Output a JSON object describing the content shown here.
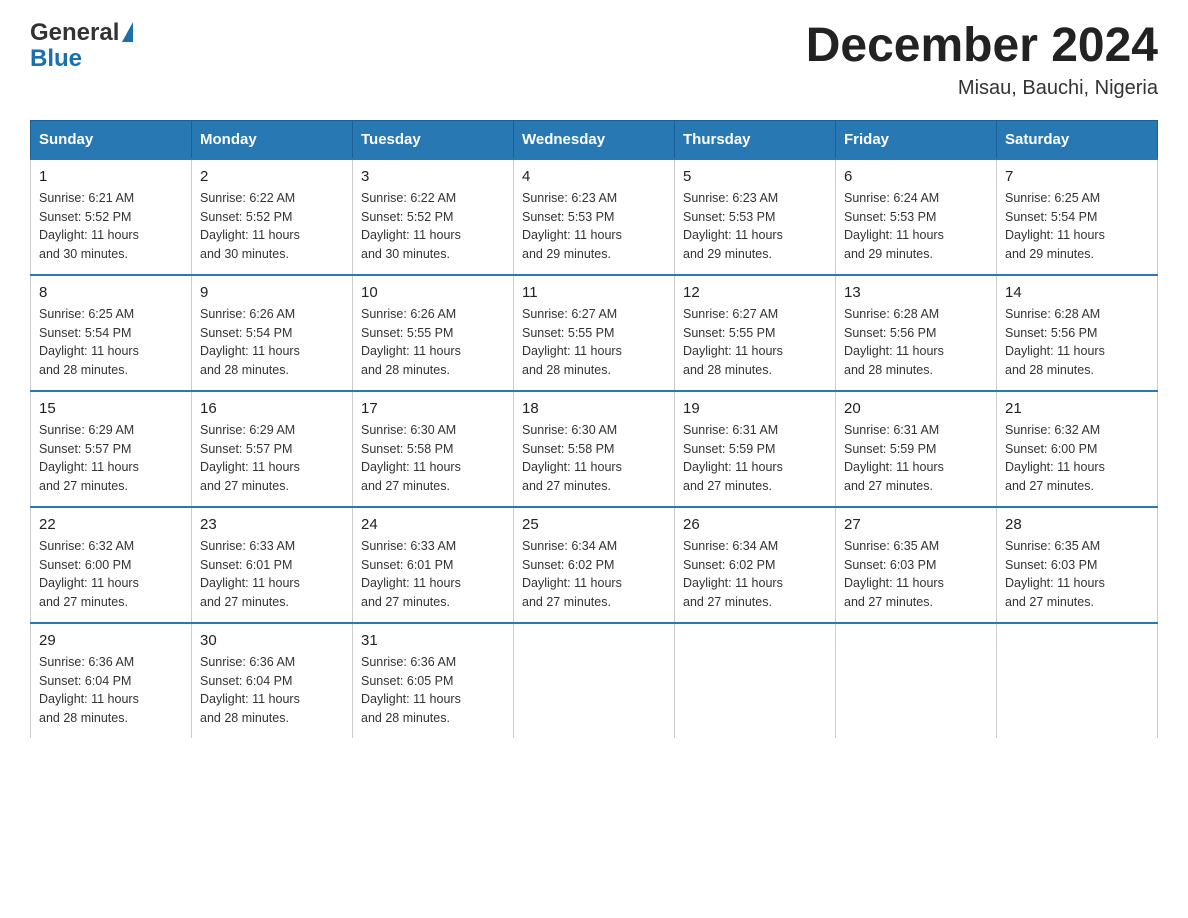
{
  "header": {
    "logo_general": "General",
    "logo_blue": "Blue",
    "month_title": "December 2024",
    "location": "Misau, Bauchi, Nigeria"
  },
  "days_of_week": [
    "Sunday",
    "Monday",
    "Tuesday",
    "Wednesday",
    "Thursday",
    "Friday",
    "Saturday"
  ],
  "weeks": [
    [
      {
        "day": "1",
        "sunrise": "6:21 AM",
        "sunset": "5:52 PM",
        "daylight": "11 hours and 30 minutes."
      },
      {
        "day": "2",
        "sunrise": "6:22 AM",
        "sunset": "5:52 PM",
        "daylight": "11 hours and 30 minutes."
      },
      {
        "day": "3",
        "sunrise": "6:22 AM",
        "sunset": "5:52 PM",
        "daylight": "11 hours and 30 minutes."
      },
      {
        "day": "4",
        "sunrise": "6:23 AM",
        "sunset": "5:53 PM",
        "daylight": "11 hours and 29 minutes."
      },
      {
        "day": "5",
        "sunrise": "6:23 AM",
        "sunset": "5:53 PM",
        "daylight": "11 hours and 29 minutes."
      },
      {
        "day": "6",
        "sunrise": "6:24 AM",
        "sunset": "5:53 PM",
        "daylight": "11 hours and 29 minutes."
      },
      {
        "day": "7",
        "sunrise": "6:25 AM",
        "sunset": "5:54 PM",
        "daylight": "11 hours and 29 minutes."
      }
    ],
    [
      {
        "day": "8",
        "sunrise": "6:25 AM",
        "sunset": "5:54 PM",
        "daylight": "11 hours and 28 minutes."
      },
      {
        "day": "9",
        "sunrise": "6:26 AM",
        "sunset": "5:54 PM",
        "daylight": "11 hours and 28 minutes."
      },
      {
        "day": "10",
        "sunrise": "6:26 AM",
        "sunset": "5:55 PM",
        "daylight": "11 hours and 28 minutes."
      },
      {
        "day": "11",
        "sunrise": "6:27 AM",
        "sunset": "5:55 PM",
        "daylight": "11 hours and 28 minutes."
      },
      {
        "day": "12",
        "sunrise": "6:27 AM",
        "sunset": "5:55 PM",
        "daylight": "11 hours and 28 minutes."
      },
      {
        "day": "13",
        "sunrise": "6:28 AM",
        "sunset": "5:56 PM",
        "daylight": "11 hours and 28 minutes."
      },
      {
        "day": "14",
        "sunrise": "6:28 AM",
        "sunset": "5:56 PM",
        "daylight": "11 hours and 28 minutes."
      }
    ],
    [
      {
        "day": "15",
        "sunrise": "6:29 AM",
        "sunset": "5:57 PM",
        "daylight": "11 hours and 27 minutes."
      },
      {
        "day": "16",
        "sunrise": "6:29 AM",
        "sunset": "5:57 PM",
        "daylight": "11 hours and 27 minutes."
      },
      {
        "day": "17",
        "sunrise": "6:30 AM",
        "sunset": "5:58 PM",
        "daylight": "11 hours and 27 minutes."
      },
      {
        "day": "18",
        "sunrise": "6:30 AM",
        "sunset": "5:58 PM",
        "daylight": "11 hours and 27 minutes."
      },
      {
        "day": "19",
        "sunrise": "6:31 AM",
        "sunset": "5:59 PM",
        "daylight": "11 hours and 27 minutes."
      },
      {
        "day": "20",
        "sunrise": "6:31 AM",
        "sunset": "5:59 PM",
        "daylight": "11 hours and 27 minutes."
      },
      {
        "day": "21",
        "sunrise": "6:32 AM",
        "sunset": "6:00 PM",
        "daylight": "11 hours and 27 minutes."
      }
    ],
    [
      {
        "day": "22",
        "sunrise": "6:32 AM",
        "sunset": "6:00 PM",
        "daylight": "11 hours and 27 minutes."
      },
      {
        "day": "23",
        "sunrise": "6:33 AM",
        "sunset": "6:01 PM",
        "daylight": "11 hours and 27 minutes."
      },
      {
        "day": "24",
        "sunrise": "6:33 AM",
        "sunset": "6:01 PM",
        "daylight": "11 hours and 27 minutes."
      },
      {
        "day": "25",
        "sunrise": "6:34 AM",
        "sunset": "6:02 PM",
        "daylight": "11 hours and 27 minutes."
      },
      {
        "day": "26",
        "sunrise": "6:34 AM",
        "sunset": "6:02 PM",
        "daylight": "11 hours and 27 minutes."
      },
      {
        "day": "27",
        "sunrise": "6:35 AM",
        "sunset": "6:03 PM",
        "daylight": "11 hours and 27 minutes."
      },
      {
        "day": "28",
        "sunrise": "6:35 AM",
        "sunset": "6:03 PM",
        "daylight": "11 hours and 27 minutes."
      }
    ],
    [
      {
        "day": "29",
        "sunrise": "6:36 AM",
        "sunset": "6:04 PM",
        "daylight": "11 hours and 28 minutes."
      },
      {
        "day": "30",
        "sunrise": "6:36 AM",
        "sunset": "6:04 PM",
        "daylight": "11 hours and 28 minutes."
      },
      {
        "day": "31",
        "sunrise": "6:36 AM",
        "sunset": "6:05 PM",
        "daylight": "11 hours and 28 minutes."
      },
      null,
      null,
      null,
      null
    ]
  ],
  "labels": {
    "sunrise": "Sunrise:",
    "sunset": "Sunset:",
    "daylight": "Daylight:"
  }
}
